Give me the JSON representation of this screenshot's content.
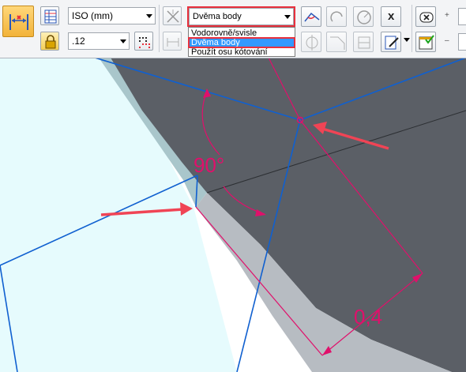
{
  "toolbar": {
    "standard_combo": {
      "value": "ISO (mm)"
    },
    "precision_combo": {
      "value": ".12"
    },
    "mode_combo": {
      "value": "Dvěma body"
    },
    "mode_options": [
      "Vodorovně/svisle",
      "Dvěma body",
      "Použít osu kótování"
    ],
    "mode_selected_index": 1,
    "plus_symbol": "+",
    "minus_symbol": "–",
    "x_button": "x"
  },
  "canvas": {
    "angle_label": "90°",
    "distance_label": "0,4"
  },
  "colors": {
    "accent_red": "#e8303d",
    "dimension_magenta": "#e0106b",
    "sketch_blue": "#1060d0",
    "face_light": "#e6fbfd",
    "face_teal": "#a9c6cb",
    "face_dark": "#5b5f66",
    "face_gray": "#b7bcc2"
  }
}
